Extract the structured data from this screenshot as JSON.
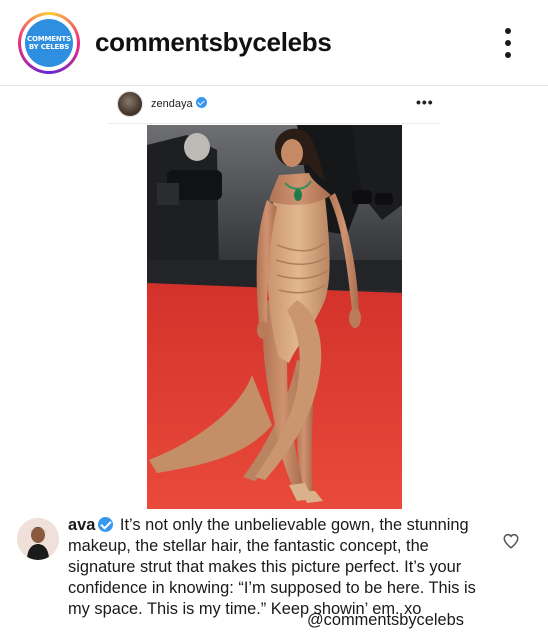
{
  "header": {
    "badge_line1": "COMMENTS",
    "badge_line2": "BY CELEBS",
    "account_name": "commentsbycelebs"
  },
  "post": {
    "username": "zendaya",
    "more_label": "•••"
  },
  "comment": {
    "username": "ava",
    "text": "It’s not only the unbelievable gown, the stunning makeup, the stellar hair, the fantastic concept, the signature strut that makes this picture perfect. It’s your confidence in knowing: “I’m supposed to be here. This is my space. This is my time.” Keep showin’ em. xo"
  },
  "watermark": "@commentsbycelebs",
  "icons": {
    "header_menu": "more-vertical-icon",
    "post_menu": "more-horizontal-icon",
    "like": "heart-outline-icon",
    "verified": "verified-badge-icon"
  },
  "colors": {
    "badge_blue": "#2e8fe0",
    "verified_blue": "#3897f0",
    "red_carpet": "#e8402f",
    "gown": "#d6a880"
  }
}
